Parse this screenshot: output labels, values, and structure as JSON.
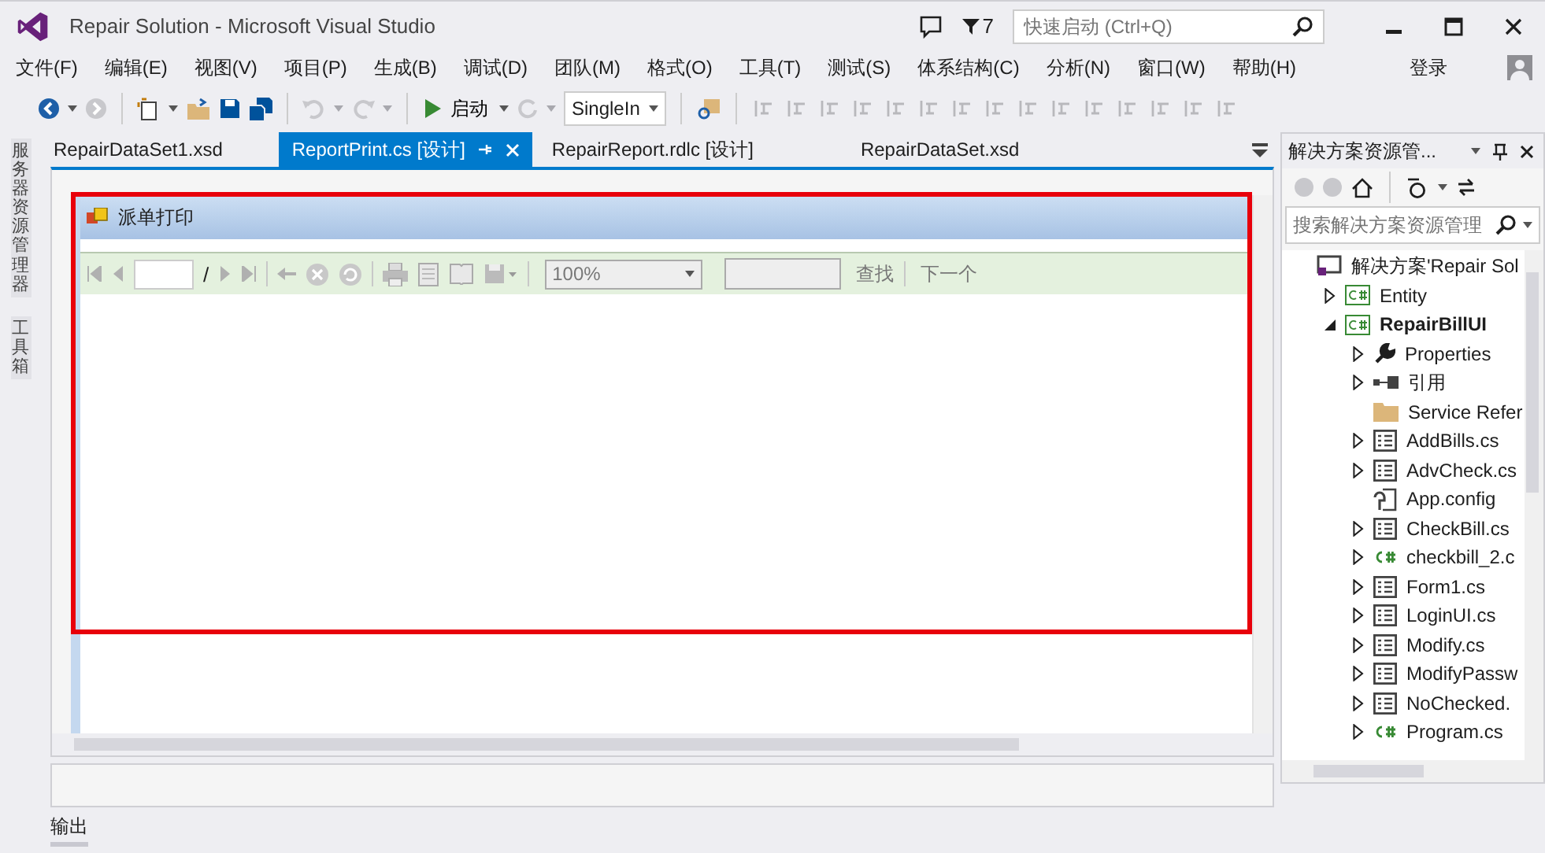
{
  "window": {
    "title": "Repair Solution - Microsoft Visual Studio",
    "notification_count": "7",
    "quick_launch": {
      "placeholder": "快速启动 (Ctrl+Q)"
    }
  },
  "menu": [
    "文件(F)",
    "编辑(E)",
    "视图(V)",
    "项目(P)",
    "生成(B)",
    "调试(D)",
    "团队(M)",
    "格式(O)",
    "工具(T)",
    "测试(S)",
    "体系结构(C)",
    "分析(N)",
    "窗口(W)",
    "帮助(H)"
  ],
  "sign_in": "登录",
  "toolbar": {
    "start": "启动",
    "configuration": "SingleIn"
  },
  "side_tabs": [
    "服务器资源管理器",
    "工具箱"
  ],
  "doc_tabs": [
    {
      "label": "RepairDataSet1.xsd",
      "selected": false
    },
    {
      "label": "ReportPrint.cs [设计]",
      "selected": true
    },
    {
      "label": "RepairReport.rdlc [设计]",
      "selected": false
    },
    {
      "label": "RepairDataSet.xsd",
      "selected": false
    }
  ],
  "form": {
    "title": "派单打印",
    "report_toolbar": {
      "page_separator": "/",
      "zoom": "100%",
      "find": "查找",
      "next": "下一个"
    }
  },
  "bottom_tab": "输出",
  "solution_explorer": {
    "title": "解决方案资源管...",
    "search_placeholder": "搜索解决方案资源管理",
    "tree": [
      {
        "label": "解决方案'Repair Sol",
        "kind": "solution",
        "children": [
          {
            "label": "Entity",
            "kind": "project",
            "expanded": false,
            "startup": false
          },
          {
            "label": "RepairBillUI",
            "kind": "project",
            "expanded": true,
            "startup": true,
            "children": [
              {
                "label": "Properties",
                "kind": "properties",
                "expanded": false
              },
              {
                "label": "引用",
                "kind": "references",
                "expanded": false
              },
              {
                "label": "Service Refer",
                "kind": "folder"
              },
              {
                "label": "AddBills.cs",
                "kind": "form",
                "expanded": false
              },
              {
                "label": "AdvCheck.cs",
                "kind": "form",
                "expanded": false
              },
              {
                "label": "App.config",
                "kind": "config"
              },
              {
                "label": "CheckBill.cs",
                "kind": "form",
                "expanded": false
              },
              {
                "label": "checkbill_2.c",
                "kind": "csharp",
                "expanded": false
              },
              {
                "label": "Form1.cs",
                "kind": "form",
                "expanded": false
              },
              {
                "label": "LoginUI.cs",
                "kind": "form",
                "expanded": false
              },
              {
                "label": "Modify.cs",
                "kind": "form",
                "expanded": false
              },
              {
                "label": "ModifyPassw",
                "kind": "form",
                "expanded": false
              },
              {
                "label": "NoChecked.",
                "kind": "form",
                "expanded": false
              },
              {
                "label": "Program.cs",
                "kind": "csharp",
                "expanded": false
              }
            ]
          }
        ]
      }
    ]
  }
}
